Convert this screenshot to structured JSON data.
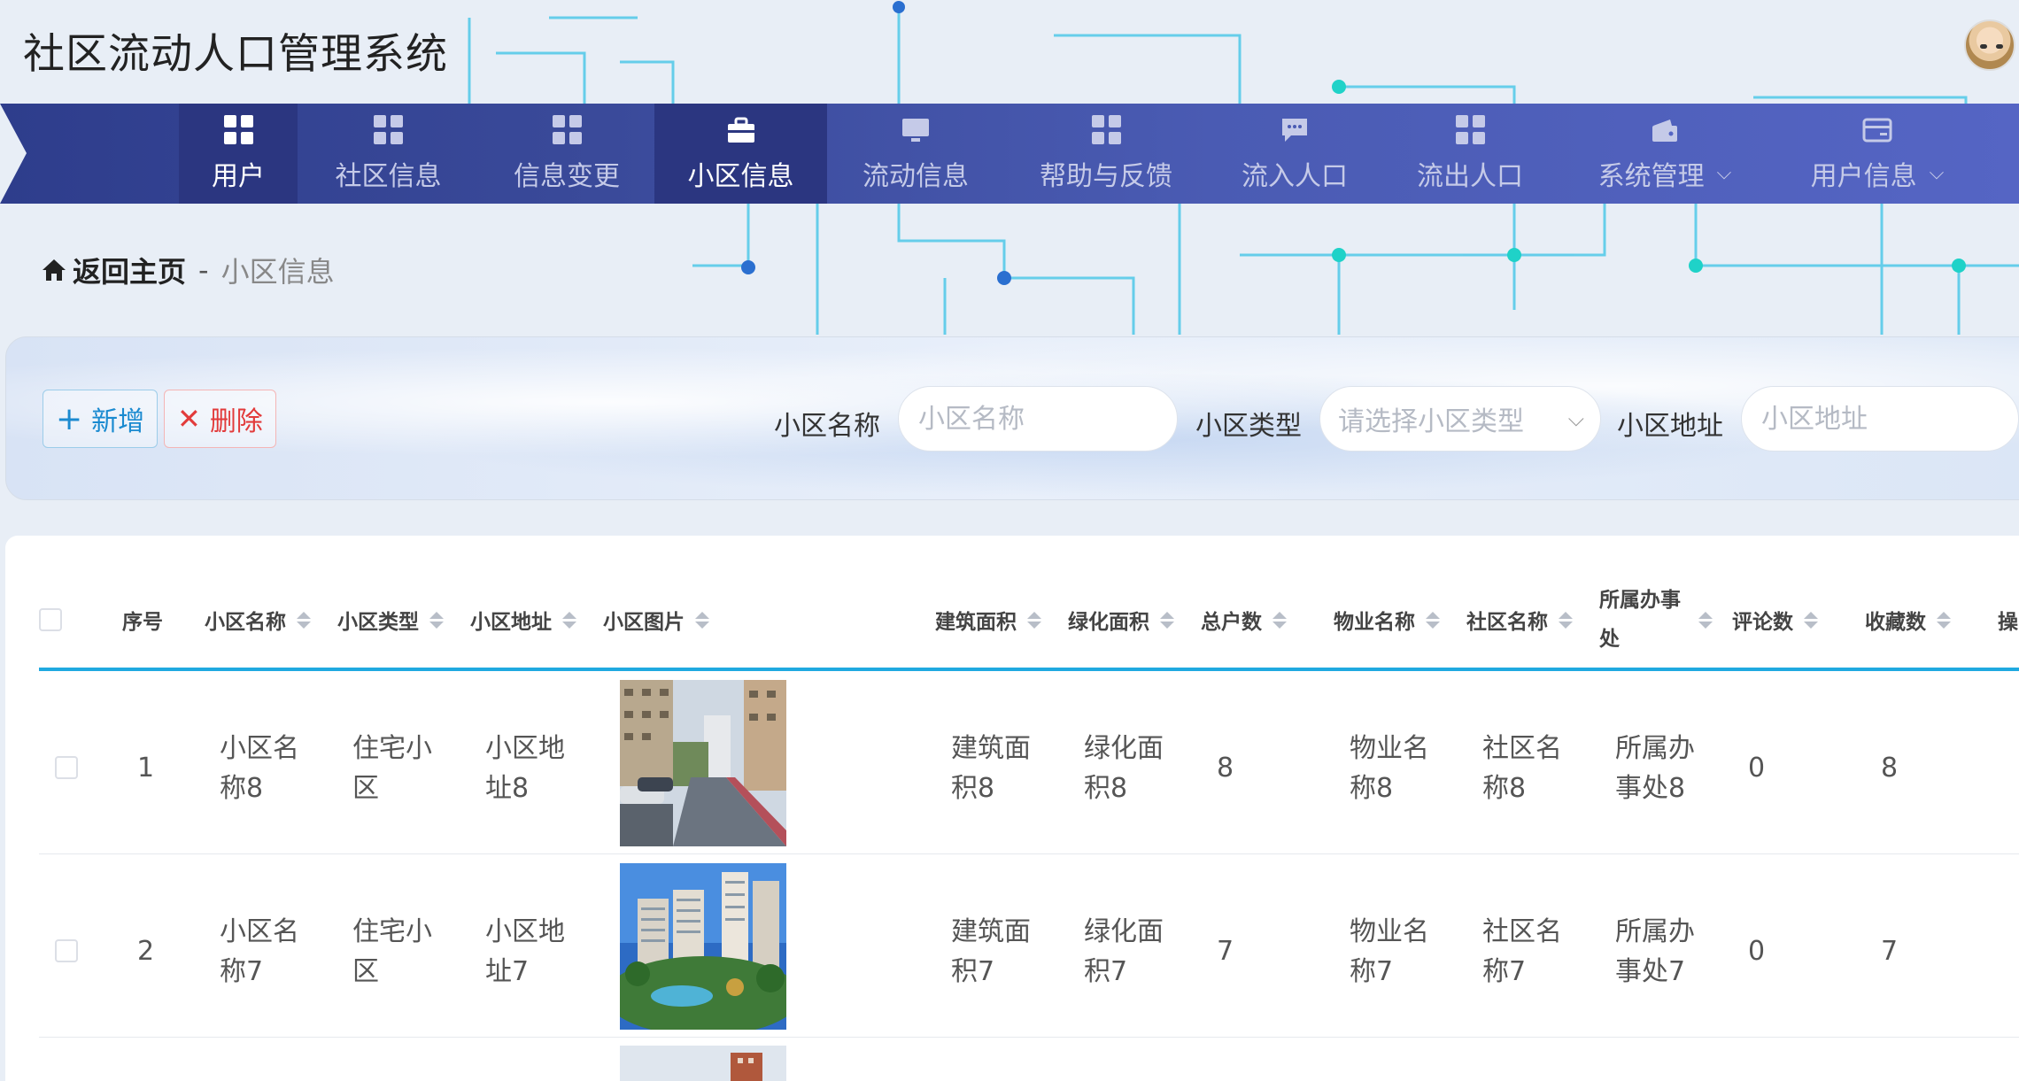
{
  "app": {
    "title": "社区流动人口管理系统"
  },
  "nav": {
    "items": [
      {
        "label": "用户",
        "icon": "grid-icon",
        "active": true
      },
      {
        "label": "社区信息",
        "icon": "grid-icon",
        "active": false
      },
      {
        "label": "信息变更",
        "icon": "grid-icon",
        "active": false
      },
      {
        "label": "小区信息",
        "icon": "briefcase-icon",
        "active": true
      },
      {
        "label": "流动信息",
        "icon": "monitor-icon",
        "active": false
      },
      {
        "label": "帮助与反馈",
        "icon": "grid-icon",
        "active": false
      },
      {
        "label": "流入人口",
        "icon": "chat-icon",
        "active": false
      },
      {
        "label": "流出人口",
        "icon": "grid-icon",
        "active": false
      },
      {
        "label": "系统管理",
        "icon": "wallet-icon",
        "active": false,
        "dropdown": true
      },
      {
        "label": "用户信息",
        "icon": "card-icon",
        "active": false,
        "dropdown": true
      }
    ]
  },
  "breadcrumb": {
    "home": "返回主页",
    "separator": "-",
    "current": "小区信息"
  },
  "toolbar": {
    "add_label": "新增",
    "delete_label": "删除"
  },
  "filters": {
    "name_label": "小区名称",
    "name_placeholder": "小区名称",
    "type_label": "小区类型",
    "type_placeholder": "请选择小区类型",
    "address_label": "小区地址",
    "address_placeholder": "小区地址"
  },
  "table": {
    "headers": {
      "index": "序号",
      "name": "小区名称",
      "type": "小区类型",
      "address": "小区地址",
      "image": "小区图片",
      "building_area": "建筑面积",
      "green_area": "绿化面积",
      "households": "总户数",
      "property": "物业名称",
      "community": "社区名称",
      "office": "所属办事处",
      "comments": "评论数",
      "favorites": "收藏数",
      "actions": "操"
    },
    "rows": [
      {
        "index": "1",
        "name": "小区名称8",
        "type": "住宅小区",
        "address": "小区地址8",
        "image": "street-photo",
        "building_area": "建筑面积8",
        "green_area": "绿化面积8",
        "households": "8",
        "property": "物业名称8",
        "community": "社区名称8",
        "office": "所属办事处8",
        "comments": "0",
        "favorites": "8"
      },
      {
        "index": "2",
        "name": "小区名称7",
        "type": "住宅小区",
        "address": "小区地址7",
        "image": "buildings-photo",
        "building_area": "建筑面积7",
        "green_area": "绿化面积7",
        "households": "7",
        "property": "物业名称7",
        "community": "社区名称7",
        "office": "所属办事处7",
        "comments": "0",
        "favorites": "7"
      }
    ]
  }
}
